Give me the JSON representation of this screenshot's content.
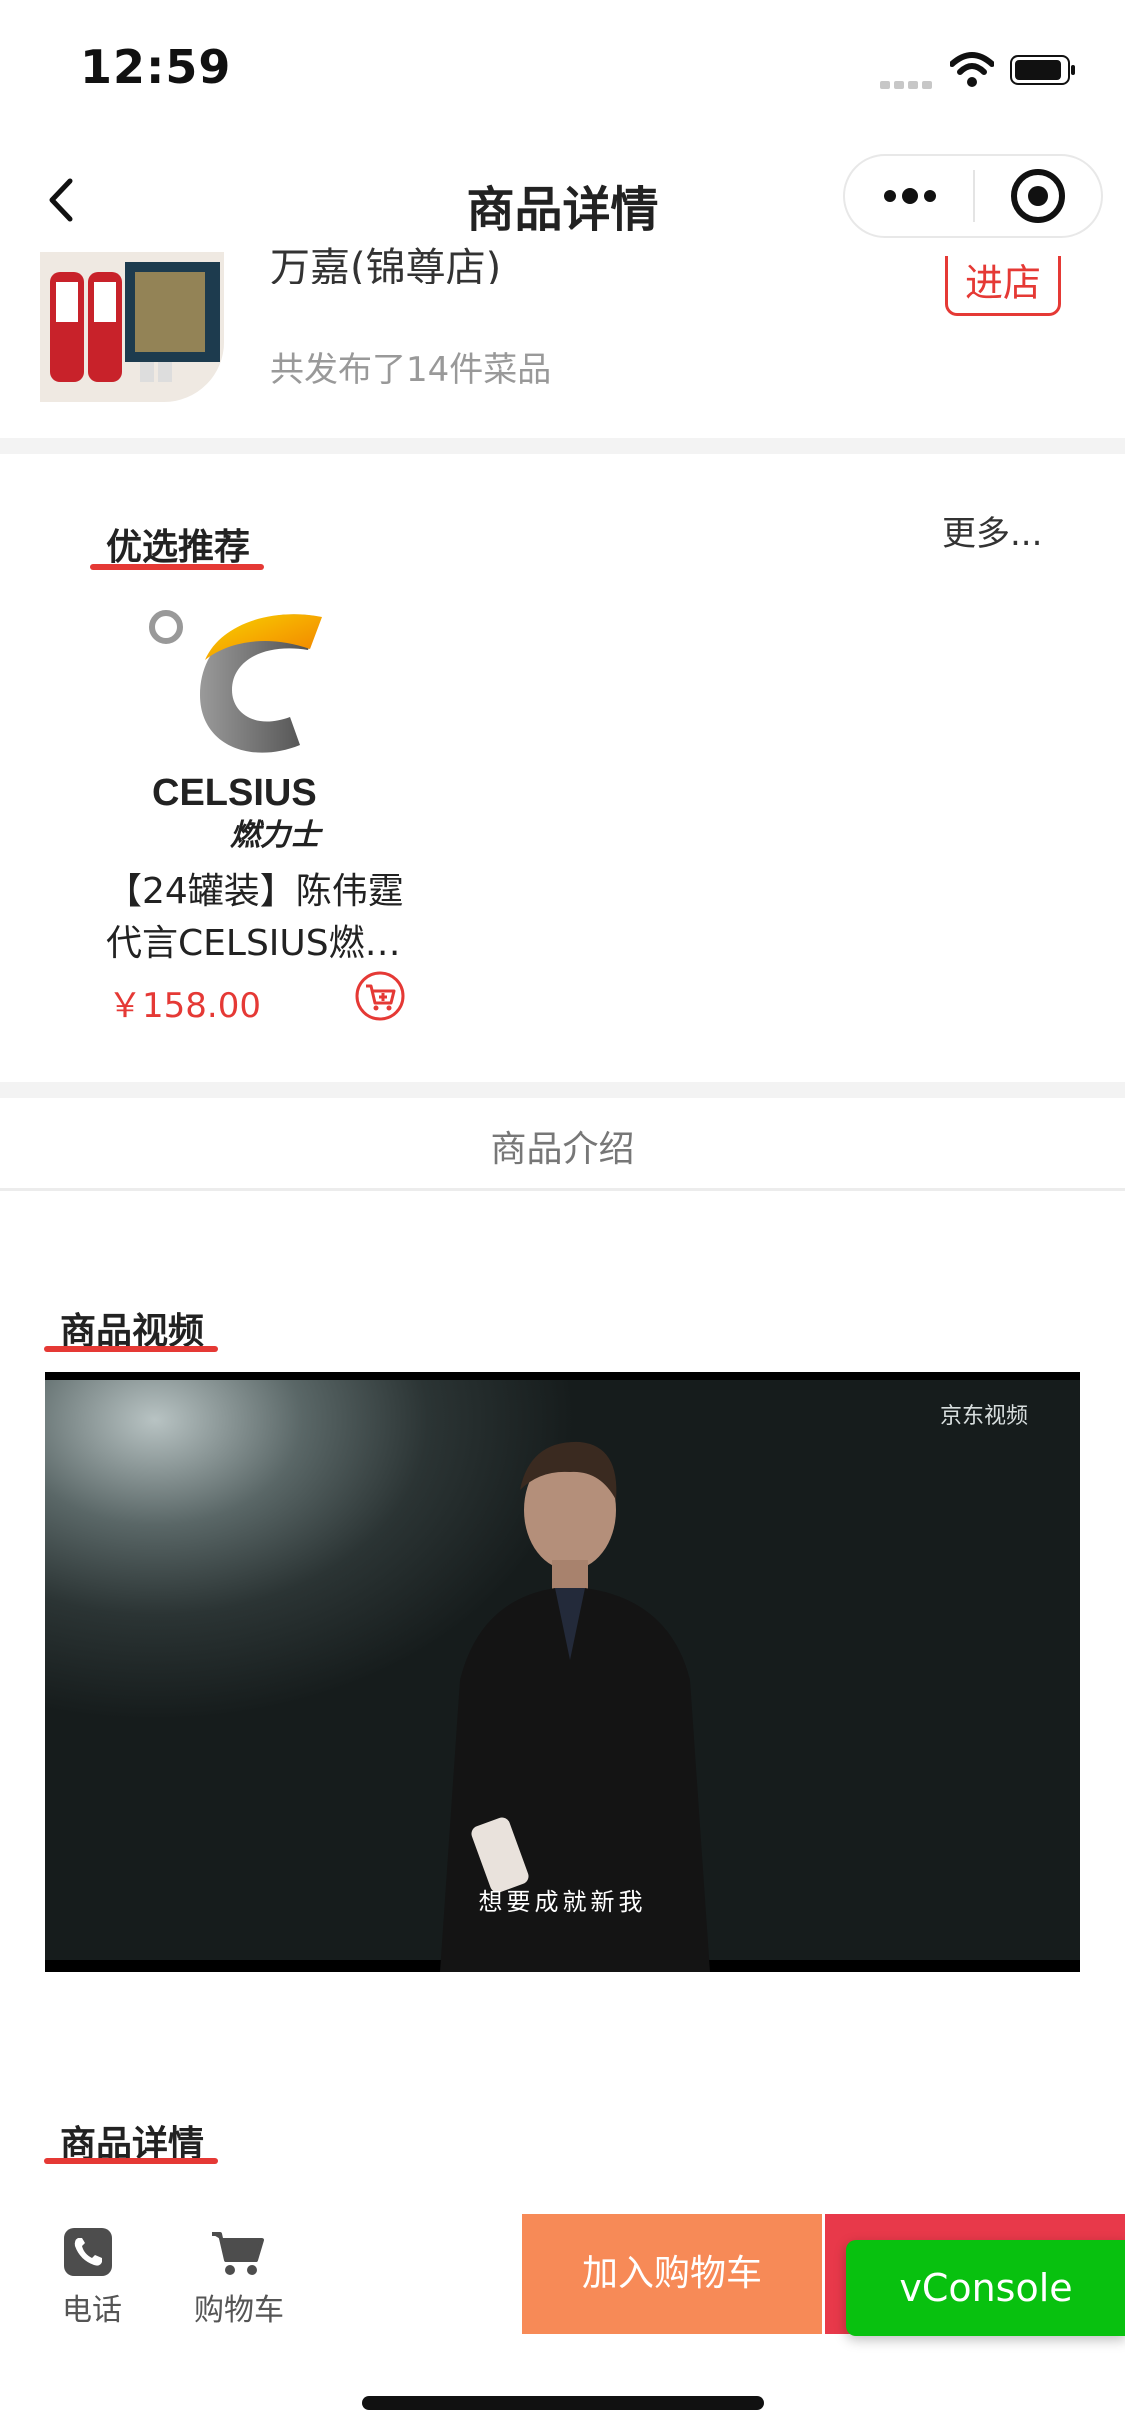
{
  "status": {
    "time": "12:59"
  },
  "nav": {
    "title": "商品详情"
  },
  "shop": {
    "name": "万嘉(锦尊店)",
    "enter_label": "进店",
    "count_text": "共发布了14件菜品"
  },
  "recommend": {
    "title": "优选推荐",
    "more_label": "更多...",
    "product": {
      "logo_text": "CELSIUS",
      "logo_sub": "燃力士",
      "name_line1": "【24罐装】陈伟霆",
      "name_line2": "代言CELSIUS燃…",
      "price": "￥158.00"
    }
  },
  "intro_tab": "商品介绍",
  "video": {
    "title": "商品视频",
    "subtitle": "想要成就新我",
    "watermark": "京东视频"
  },
  "detail": {
    "title": "商品详情"
  },
  "bottom": {
    "phone_label": "电话",
    "cart_label": "购物车",
    "add_cart_label": "加入购物车",
    "vconsole_label": "vConsole"
  },
  "colors": {
    "accent_red": "#e53935",
    "add_cart_orange": "#f78a57",
    "vconsole_green": "#08c10f"
  }
}
